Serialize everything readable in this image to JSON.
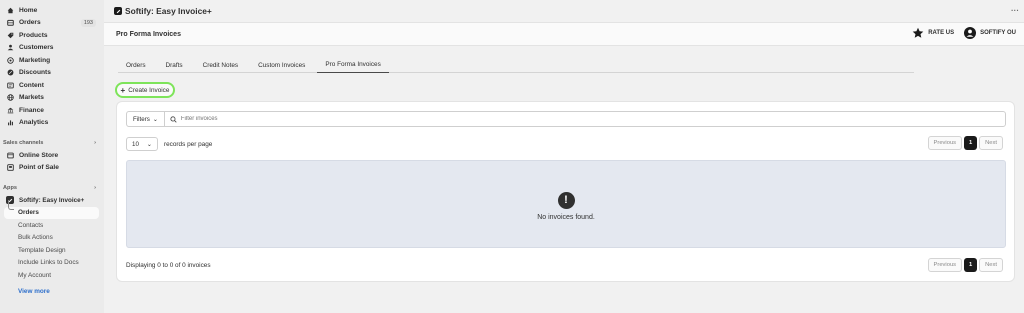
{
  "sidebar": {
    "nav": [
      {
        "label": "Home",
        "icon": "home-icon"
      },
      {
        "label": "Orders",
        "icon": "orders-icon",
        "badge": "193"
      },
      {
        "label": "Products",
        "icon": "tag-icon"
      },
      {
        "label": "Customers",
        "icon": "person-icon"
      },
      {
        "label": "Marketing",
        "icon": "target-icon"
      },
      {
        "label": "Discounts",
        "icon": "discount-icon"
      },
      {
        "label": "Content",
        "icon": "content-icon"
      },
      {
        "label": "Markets",
        "icon": "globe-icon"
      },
      {
        "label": "Finance",
        "icon": "bank-icon"
      },
      {
        "label": "Analytics",
        "icon": "chart-icon"
      }
    ],
    "sales_channels_heading": "Sales channels",
    "sales_channels": [
      {
        "label": "Online Store",
        "icon": "store-icon"
      },
      {
        "label": "Point of Sale",
        "icon": "pos-icon"
      }
    ],
    "apps_heading": "Apps",
    "app_name": "Softify: Easy Invoice+",
    "app_items": [
      "Orders",
      "Contacts",
      "Bulk Actions",
      "Template Design",
      "Include Links to Docs",
      "My Account"
    ],
    "view_more": "View more",
    "chevron": "›"
  },
  "appbar": {
    "title": "Softify: Easy Invoice+",
    "more": "···"
  },
  "header": {
    "title": "Pro Forma Invoices",
    "rate_us": "RATE US",
    "account": "SOFTIFY OU"
  },
  "tabs": [
    "Orders",
    "Drafts",
    "Credit Notes",
    "Custom Invoices",
    "Pro Forma Invoices"
  ],
  "active_tab": "Pro Forma Invoices",
  "create_button": "Create Invoice",
  "filters": {
    "label": "Filters",
    "placeholder": "Filter invoices"
  },
  "per_page": {
    "value": "10",
    "label": "records per page"
  },
  "pagination": {
    "previous": "Previous",
    "current": "1",
    "next": "Next"
  },
  "empty_state": {
    "message": "No invoices found.",
    "icon": "!"
  },
  "footer": {
    "summary": "Displaying 0 to 0 of 0 invoices"
  },
  "colors": {
    "highlight": "#7ee45a",
    "empty_bg": "#e4e8f0",
    "dark": "#1a1a1a"
  }
}
